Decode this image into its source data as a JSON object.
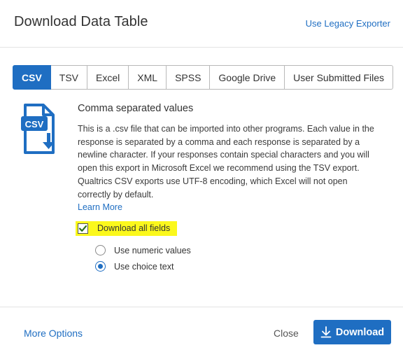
{
  "header": {
    "title": "Download Data Table",
    "legacy_link": "Use Legacy Exporter"
  },
  "tabs": [
    {
      "label": "CSV",
      "active": true
    },
    {
      "label": "TSV",
      "active": false
    },
    {
      "label": "Excel",
      "active": false
    },
    {
      "label": "XML",
      "active": false
    },
    {
      "label": "SPSS",
      "active": false
    },
    {
      "label": "Google Drive",
      "active": false
    },
    {
      "label": "User Submitted Files",
      "active": false
    }
  ],
  "format": {
    "icon_label": "CSV",
    "icon": "csv-file-download-icon",
    "title": "Comma separated values",
    "description": "This is a .csv file that can be imported into other programs. Each value in the response is separated by a comma and each response is separated by a newline character. If your responses contain special characters and you will open this export in Microsoft Excel we recommend using the TSV export. Qualtrics CSV exports use UTF-8 encoding, which Excel will not open correctly by default.",
    "learn_more": "Learn More"
  },
  "options": {
    "download_all_fields": {
      "label": "Download all fields",
      "checked": true
    },
    "values": [
      {
        "label": "Use numeric values",
        "selected": false
      },
      {
        "label": "Use choice text",
        "selected": true
      }
    ]
  },
  "footer": {
    "more_options": "More Options",
    "close": "Close",
    "download": "Download"
  },
  "colors": {
    "accent": "#1f6ec2",
    "highlight": "#fbf81c"
  }
}
